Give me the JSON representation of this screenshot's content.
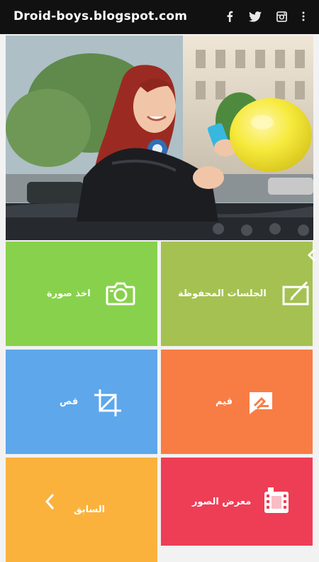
{
  "app": {
    "title": "Droid-boys.blogspot.com"
  },
  "topbar_icons": [
    "facebook-icon",
    "twitter-icon",
    "instagram-icon",
    "overflow-menu-icon"
  ],
  "tiles": {
    "take_photo": {
      "label": "اخذ صورة",
      "icon": "camera-icon",
      "color": "#88d14c"
    },
    "saved_sessions": {
      "label": "الجلسات المحفوظة",
      "icon": "edit-canvas-icon",
      "color": "#a5c152"
    },
    "crop": {
      "label": "قص",
      "icon": "crop-icon",
      "color": "#5ea7eb"
    },
    "rate": {
      "label": "قيم",
      "icon": "rate-chat-icon",
      "color": "#f77d45"
    },
    "previous": {
      "label": "السابق",
      "icon": "chevron-left-icon",
      "color": "#fbb23d"
    },
    "gallery": {
      "label": "معرض الصور",
      "icon": "film-gallery-icon",
      "color": "#ee3e56"
    }
  },
  "colors": {
    "topbar": "#111111",
    "background": "#f2f2f2"
  }
}
